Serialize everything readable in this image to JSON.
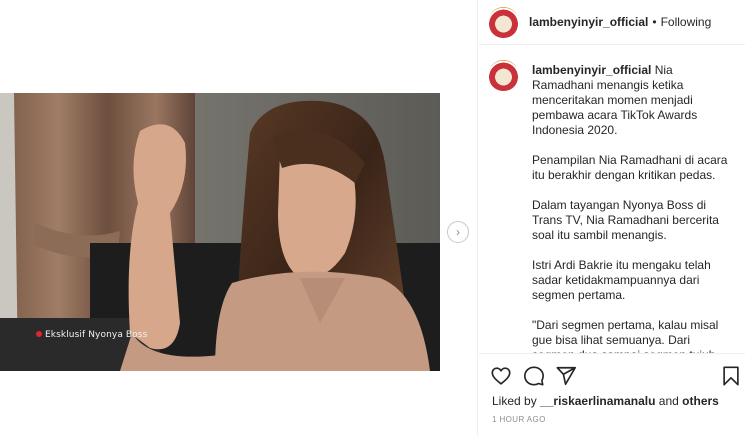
{
  "post": {
    "watermark": "Eksklusif Nyonya Boss"
  },
  "header": {
    "username": "lambenyinyir_official",
    "separator": "•",
    "follow_label": "Following"
  },
  "caption": {
    "username": "lambenyinyir_official",
    "paragraphs": [
      "Nia Ramadhani menangis ketika menceritakan momen menjadi pembawa acara TikTok Awards Indonesia 2020.",
      "Penampilan Nia Ramadhani di acara itu berakhir dengan kritikan pedas.",
      "Dalam tayangan Nyonya Boss di Trans TV, Nia Ramadhani bercerita soal itu sambil menangis.",
      "Istri Ardi Bakrie itu mengaku telah sadar ketidakmampuannya dari segmen pertama.",
      "\"Dari segmen pertama, kalau misal gue bisa lihat semuanya. Dari segmen dua sampai segmen tujuh gue rasa gue lagi mempermalukan diri gue"
    ]
  },
  "likes": {
    "prefix": "Liked by",
    "user": "__riskaerlinamanalu",
    "joiner": "and",
    "others": "others"
  },
  "timestamp": "1 HOUR AGO",
  "icons": [
    "heart-icon",
    "comment-icon",
    "share-icon",
    "bookmark-icon",
    "chevron-right-icon"
  ]
}
